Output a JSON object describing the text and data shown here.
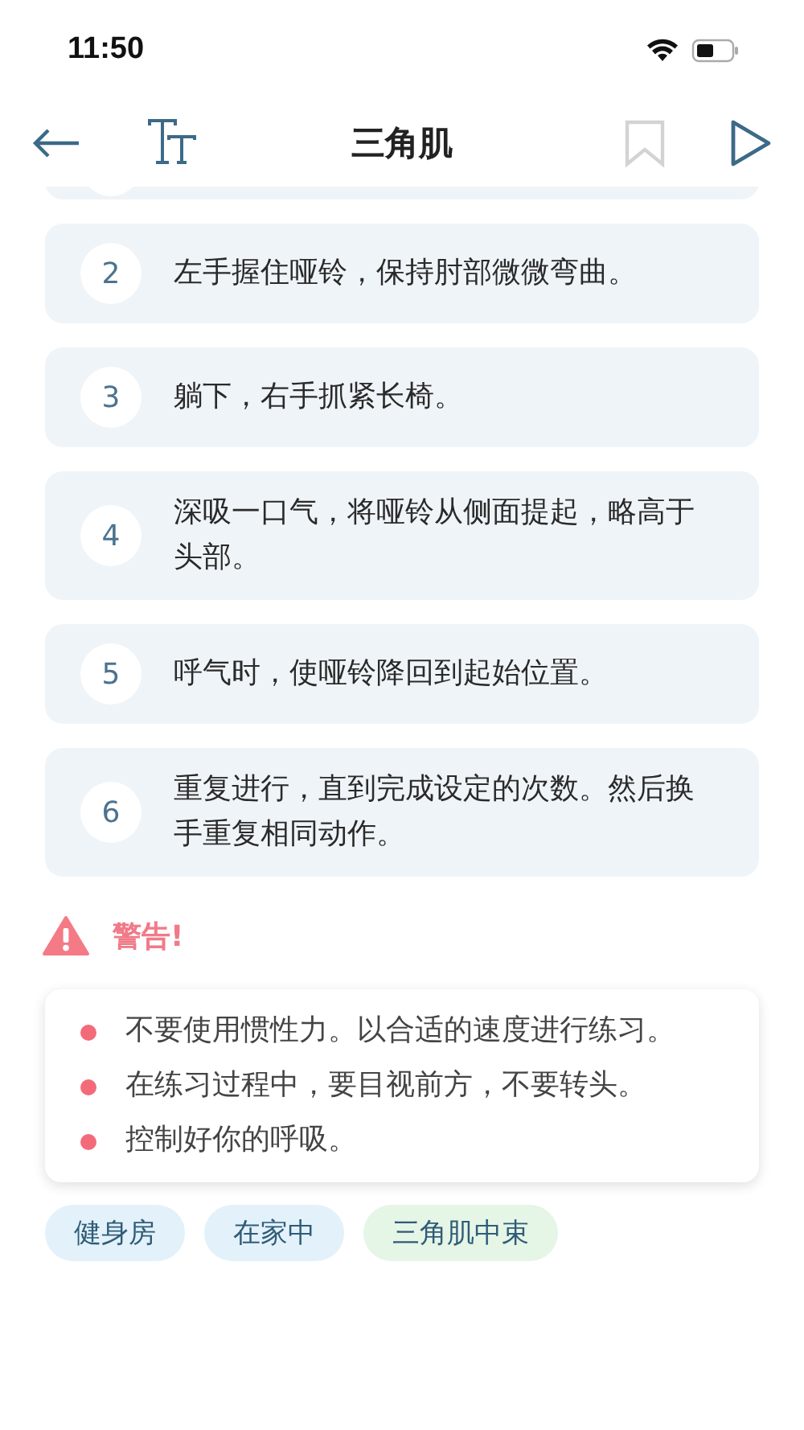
{
  "status_bar": {
    "time": "11:50"
  },
  "header": {
    "title": "三角肌",
    "bookmarked": false
  },
  "steps": [
    {
      "number": "2",
      "text": "左手握住哑铃，保持肘部微微弯曲。"
    },
    {
      "number": "3",
      "text": "躺下，右手抓紧长椅。"
    },
    {
      "number": "4",
      "text": "深吸一口气，将哑铃从侧面提起，略高于头部。"
    },
    {
      "number": "5",
      "text": "呼气时，使哑铃降回到起始位置。"
    },
    {
      "number": "6",
      "text": "重复进行，直到完成设定的次数。然后换手重复相同动作。"
    }
  ],
  "warning": {
    "title": "警告!",
    "items": [
      "不要使用惯性力。以合适的速度进行练习。",
      "在练习过程中，要目视前方，不要转头。",
      "控制好你的呼吸。"
    ]
  },
  "tags": [
    {
      "label": "健身房",
      "color": "#e3f1fa"
    },
    {
      "label": "在家中",
      "color": "#e3f1fa"
    },
    {
      "label": "三角肌中束",
      "color": "#e5f5e6"
    }
  ]
}
